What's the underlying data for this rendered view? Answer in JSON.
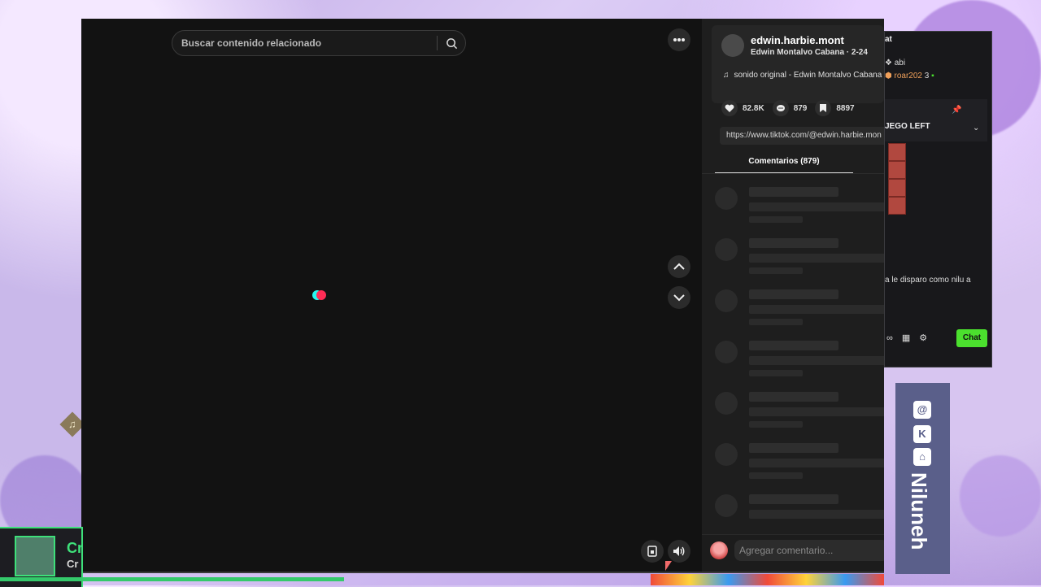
{
  "search": {
    "placeholder": "Buscar contenido relacionado"
  },
  "post": {
    "username": "edwin.harbie.mont",
    "nickname_date": "Edwin Montalvo Cabana · 2-24",
    "sound": "sonido original - Edwin Montalvo Cabana",
    "likes": "82.8K",
    "comments": "879",
    "saves": "8897",
    "url": "https://www.tiktok.com/@edwin.harbie.mon"
  },
  "comments_tab": {
    "label": "Comentarios (879)"
  },
  "comment_input": {
    "placeholder": "Agregar comentario..."
  },
  "chat_overlay": {
    "title": "at",
    "line1": "abi",
    "line2": "roar202",
    "line2_badge": "3",
    "pinned_title": "JEGO LEFT",
    "message": "a le disparo como nilu a",
    "chat_button": "Chat"
  },
  "social": {
    "name": "Niluneh"
  },
  "stream": {
    "name": "Cr",
    "subtitle": "Cr"
  },
  "colors": {
    "accent_cyan": "#25f4ee",
    "accent_pink": "#fe2c55",
    "chat_green": "#4be02e"
  }
}
